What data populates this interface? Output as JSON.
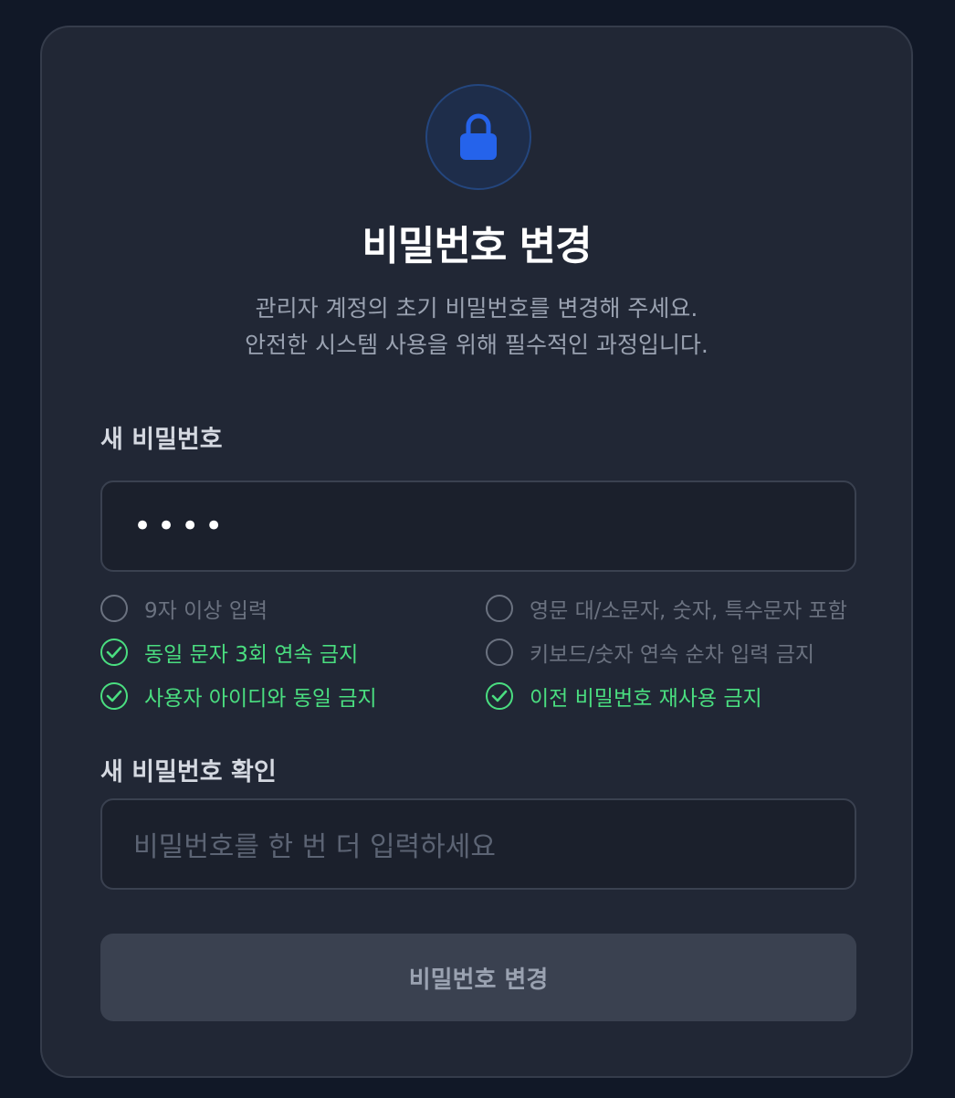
{
  "header": {
    "icon": "lock-icon",
    "accent_color": "#2563eb",
    "title": "비밀번호 변경",
    "subtitle_line1": "관리자 계정의 초기 비밀번호를 변경해 주세요.",
    "subtitle_line2": "안전한 시스템 사용을 위해 필수적인 과정입니다."
  },
  "new_password": {
    "label": "새 비밀번호",
    "value": "••••"
  },
  "rules": {
    "met_color": "#4ade80",
    "unmet_color": "#6b7280",
    "items": [
      {
        "label": "9자 이상 입력",
        "met": false
      },
      {
        "label": "영문 대/소문자, 숫자, 특수문자 포함",
        "met": false
      },
      {
        "label": "동일 문자 3회 연속 금지",
        "met": true
      },
      {
        "label": "키보드/숫자 연속 순차 입력 금지",
        "met": false
      },
      {
        "label": "사용자 아이디와 동일 금지",
        "met": true
      },
      {
        "label": "이전 비밀번호 재사용 금지",
        "met": true
      }
    ]
  },
  "confirm_password": {
    "label": "새 비밀번호 확인",
    "value": "",
    "placeholder": "비밀번호를 한 번 더 입력하세요"
  },
  "submit": {
    "label": "비밀번호 변경"
  }
}
